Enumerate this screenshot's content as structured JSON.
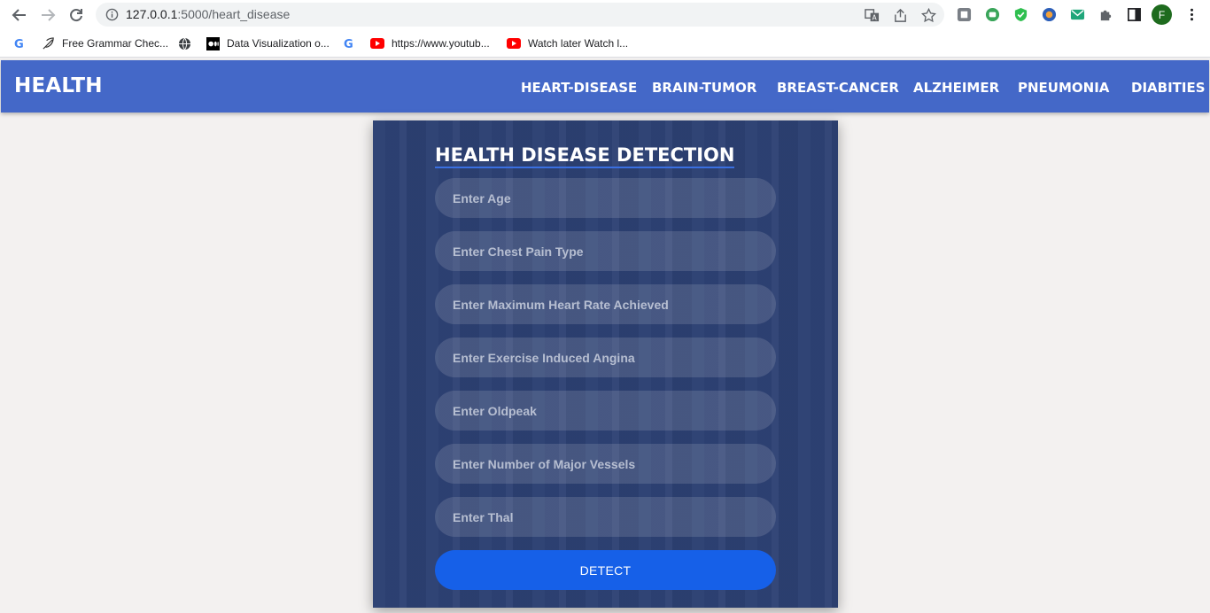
{
  "browser": {
    "url_host": "127.0.0.1",
    "url_path": ":5000/heart_disease",
    "avatar_letter": "F",
    "bookmarks": [
      {
        "label": "",
        "icon": "google-icon"
      },
      {
        "label": "Free Grammar Chec...",
        "icon": "feather-icon"
      },
      {
        "label": "",
        "icon": "globe-icon"
      },
      {
        "label": "Data Visualization o...",
        "icon": "medium-icon"
      },
      {
        "label": "",
        "icon": "google-icon"
      },
      {
        "label": "https://www.youtub...",
        "icon": "youtube-icon"
      },
      {
        "label": "Watch later Watch l...",
        "icon": "youtube-icon"
      }
    ]
  },
  "navbar": {
    "brand": "HEALTH",
    "links": [
      "HEART-DISEASE",
      "BRAIN-TUMOR",
      "BREAST-CANCER",
      "ALZHEIMER",
      "PNEUMONIA",
      "DIABITIES"
    ]
  },
  "form": {
    "title": "HEALTH DISEASE DETECTION",
    "fields": [
      {
        "placeholder": "Enter Age",
        "value": ""
      },
      {
        "placeholder": "Enter Chest Pain Type",
        "value": ""
      },
      {
        "placeholder": "Enter Maximum Heart Rate Achieved",
        "value": ""
      },
      {
        "placeholder": "Enter Exercise Induced Angina",
        "value": ""
      },
      {
        "placeholder": "Enter Oldpeak",
        "value": ""
      },
      {
        "placeholder": "Enter Number of Major Vessels",
        "value": ""
      },
      {
        "placeholder": "Enter Thal",
        "value": ""
      }
    ],
    "submit_label": "DETECT"
  },
  "colors": {
    "navbar": "#4468c8",
    "button": "#1660e8",
    "card_overlay": "#283c70",
    "page_bg": "#f3f1f0"
  }
}
